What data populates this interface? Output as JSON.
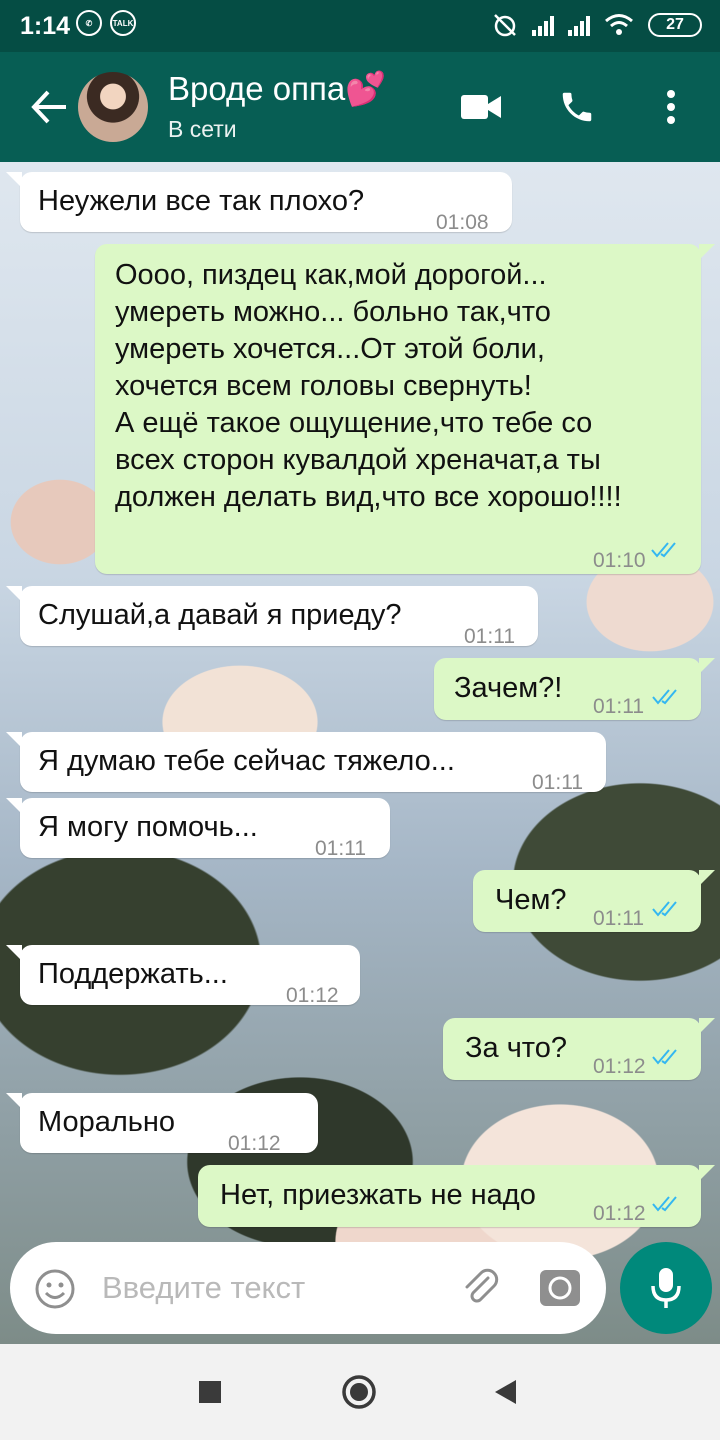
{
  "status_bar": {
    "time": "1:14",
    "talk_badge": "TALK",
    "battery": "27"
  },
  "header": {
    "contact_name": "Вроде оппа💕",
    "contact_status": "В сети"
  },
  "messages": [
    {
      "side": "in",
      "text": "Неужели все так плохо?",
      "time": "01:08"
    },
    {
      "side": "out",
      "text": "Оооо, пиздец как,мой дорогой...\nумереть можно... больно так,что\nумереть хочется...От этой боли,\nхочется всем головы свернуть!\nА ещё такое ощущение,что тебе со\nвсех сторон кувалдой хреначат,а ты\nдолжен делать вид,что все хорошо!!!!",
      "time": "01:10",
      "read": true
    },
    {
      "side": "in",
      "text": "Слушай,а давай я приеду?",
      "time": "01:11"
    },
    {
      "side": "out",
      "text": "Зачем?!",
      "time": "01:11",
      "read": true
    },
    {
      "side": "in",
      "text": "Я думаю тебе сейчас тяжело...",
      "time": "01:11"
    },
    {
      "side": "in",
      "text": "Я могу помочь...",
      "time": "01:11"
    },
    {
      "side": "out",
      "text": "Чем?",
      "time": "01:11",
      "read": true
    },
    {
      "side": "in",
      "text": "Поддержать...",
      "time": "01:12"
    },
    {
      "side": "out",
      "text": "За что?",
      "time": "01:12",
      "read": true
    },
    {
      "side": "in",
      "text": "Морально",
      "time": "01:12"
    },
    {
      "side": "out",
      "text": "Нет, приезжать не надо",
      "time": "01:12",
      "read": true
    }
  ],
  "input": {
    "placeholder": "Введите текст"
  },
  "colors": {
    "status_bar": "#054d44",
    "header": "#075e54",
    "incoming_bubble": "#ffffff",
    "outgoing_bubble": "#dcf8c6",
    "read_ticks": "#34b7f1",
    "mic_button": "#00897b"
  },
  "icons": {
    "header": [
      "back-arrow-icon",
      "video-call-icon",
      "phone-icon",
      "more-vert-icon"
    ],
    "input": [
      "emoji-icon",
      "attach-icon",
      "camera-icon",
      "mic-icon"
    ],
    "nav": [
      "recents-square-icon",
      "home-circle-icon",
      "back-triangle-icon"
    ]
  }
}
